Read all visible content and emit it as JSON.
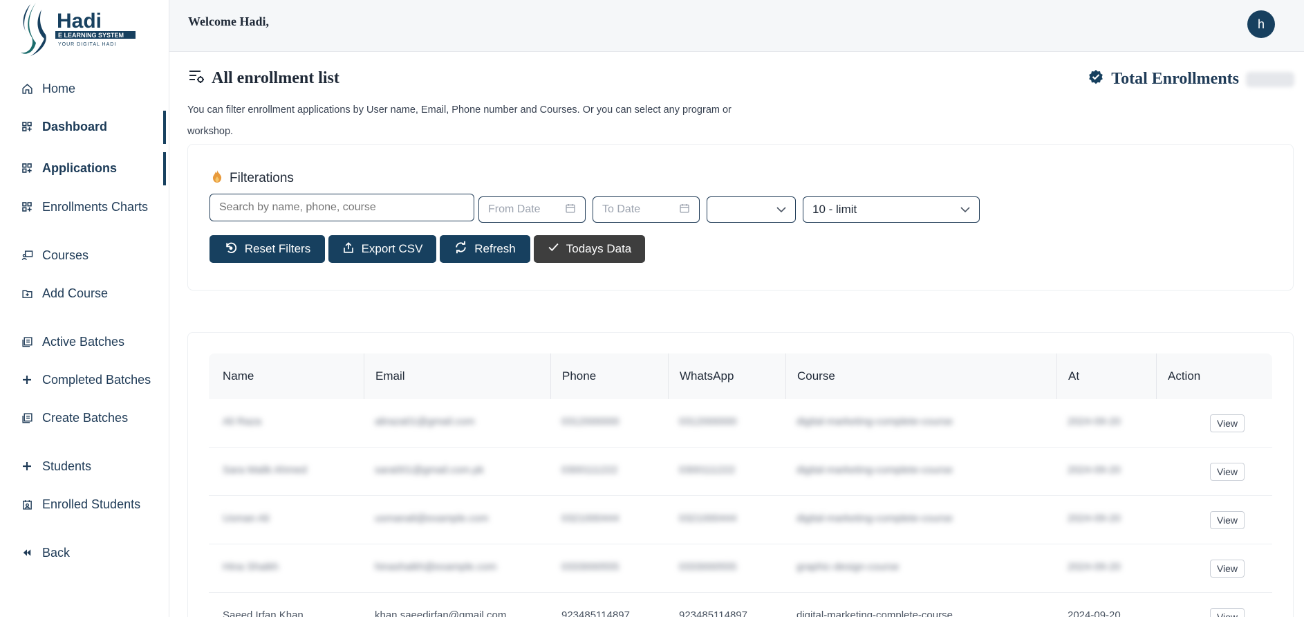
{
  "app": {
    "brand_name": "Hadi",
    "brand_sub": "E LEARNING SYSTEM",
    "brand_tagline": "YOUR DIGITAL HADI"
  },
  "colors": {
    "primary": "#17405f",
    "dark_button": "#3e3e3e",
    "header_bg": "#f5f7f9"
  },
  "sidebar": {
    "items": [
      {
        "label": "Home",
        "icon": "home-icon"
      },
      {
        "label": "Dashboard",
        "icon": "grid-plus-icon",
        "active": true
      },
      {
        "label": "Applications",
        "icon": "grid-plus-icon",
        "active": true
      },
      {
        "label": "Enrollments Charts",
        "icon": "grid-plus-icon"
      },
      {
        "label": "Courses",
        "icon": "teacher-board-icon"
      },
      {
        "label": "Add Course",
        "icon": "folder-plus-icon"
      },
      {
        "label": "Active Batches",
        "icon": "book-stack-icon"
      },
      {
        "label": "Completed Batches",
        "icon": "plus-icon"
      },
      {
        "label": "Create Batches",
        "icon": "book-stack-icon"
      },
      {
        "label": "Students",
        "icon": "plus-icon"
      },
      {
        "label": "Enrolled Students",
        "icon": "user-calendar-icon"
      },
      {
        "label": "Back",
        "icon": "double-chevron-left-icon"
      }
    ]
  },
  "header": {
    "welcome": "Welcome Hadi,",
    "avatar_initial": "h"
  },
  "page": {
    "title": "All enrollment list",
    "total_label": "Total Enrollments",
    "description": "You can filter enrollment applications by User name, Email, Phone number and Courses. Or you can select any program or workshop."
  },
  "filters": {
    "title": "Filterations",
    "search_placeholder": "Search by name, phone, course",
    "from_date_placeholder": "From Date",
    "to_date_placeholder": "To Date",
    "program_value": "",
    "limit_value": "10 - limit",
    "buttons": {
      "reset": "Reset Filters",
      "export": "Export CSV",
      "refresh": "Refresh",
      "today": "Todays Data"
    }
  },
  "table": {
    "headers": [
      "Name",
      "Email",
      "Phone",
      "WhatsApp",
      "Course",
      "At",
      "Action"
    ],
    "rows": [
      {
        "name": "Ali Raza",
        "email": "aliraza01@gmail.com",
        "phone": "0312000000",
        "whatsapp": "0312000000",
        "course": "digital-marketing-complete-course",
        "at": "2024-09-20",
        "action": "View"
      },
      {
        "name": "Sara Malik Ahmed",
        "email": "sara001@gmail.com.pk",
        "phone": "0300111222",
        "whatsapp": "0300111222",
        "course": "digital-marketing-complete-course",
        "at": "2024-09-20",
        "action": "View"
      },
      {
        "name": "Usman Ali",
        "email": "usmanali@example.com",
        "phone": "0321000444",
        "whatsapp": "0321000444",
        "course": "digital-marketing-complete-course",
        "at": "2024-09-20",
        "action": "View"
      },
      {
        "name": "Hina Shaikh",
        "email": "hinashaikh@example.com",
        "phone": "0333000555",
        "whatsapp": "0333000555",
        "course": "graphic-design-course",
        "at": "2024-09-20",
        "action": "View"
      },
      {
        "name": "Saeed Irfan Khan",
        "email": "khan.saeedirfan@gmail.com",
        "phone": "923485114897",
        "whatsapp": "923485114897",
        "course": "digital-marketing-complete-course",
        "at": "2024-09-20",
        "action": "View"
      }
    ]
  }
}
